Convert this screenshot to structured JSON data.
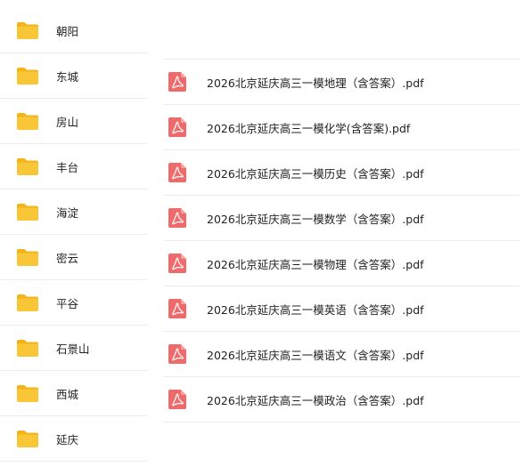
{
  "folders": [
    {
      "label": "朝阳",
      "icon": "folder-icon"
    },
    {
      "label": "东城",
      "icon": "folder-icon"
    },
    {
      "label": "房山",
      "icon": "folder-icon"
    },
    {
      "label": "丰台",
      "icon": "folder-icon"
    },
    {
      "label": "海淀",
      "icon": "folder-icon"
    },
    {
      "label": "密云",
      "icon": "folder-icon"
    },
    {
      "label": "平谷",
      "icon": "folder-icon"
    },
    {
      "label": "石景山",
      "icon": "folder-icon"
    },
    {
      "label": "西城",
      "icon": "folder-icon"
    },
    {
      "label": "延庆",
      "icon": "folder-icon"
    }
  ],
  "files": [
    {
      "name": "2026北京延庆高三一模地理（含答案）.pdf",
      "icon": "pdf-icon"
    },
    {
      "name": "2026北京延庆高三一模化学(含答案).pdf",
      "icon": "pdf-icon"
    },
    {
      "name": "2026北京延庆高三一模历史（含答案）.pdf",
      "icon": "pdf-icon"
    },
    {
      "name": "2026北京延庆高三一模数学（含答案）.pdf",
      "icon": "pdf-icon"
    },
    {
      "name": "2026北京延庆高三一模物理（含答案）.pdf",
      "icon": "pdf-icon"
    },
    {
      "name": "2026北京延庆高三一模英语（含答案）.pdf",
      "icon": "pdf-icon"
    },
    {
      "name": "2026北京延庆高三一模语文（含答案）.pdf",
      "icon": "pdf-icon"
    },
    {
      "name": "2026北京延庆高三一模政治（含答案）.pdf",
      "icon": "pdf-icon"
    }
  ],
  "colors": {
    "folder": "#f9c637",
    "folder_tab": "#f2b418",
    "pdf": "#ef6a6a",
    "divider": "#ececec"
  }
}
